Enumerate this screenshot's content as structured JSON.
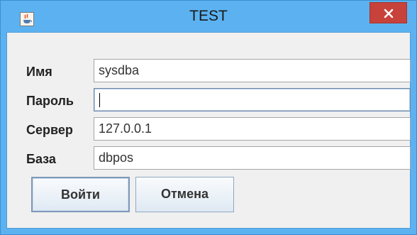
{
  "window": {
    "title": "TEST",
    "close_symbol": "✕",
    "app_icon": "java-icon"
  },
  "form": {
    "fields": [
      {
        "label": "Имя",
        "value": "sysdba"
      },
      {
        "label": "Пароль",
        "value": ""
      },
      {
        "label": "Сервер",
        "value": "127.0.0.1"
      },
      {
        "label": "База",
        "value": "dbpos"
      }
    ]
  },
  "buttons": {
    "login": "Войти",
    "cancel": "Отмена"
  },
  "colors": {
    "frame": "#5cb2f0",
    "close": "#c7423b",
    "client": "#f0f0f0"
  }
}
